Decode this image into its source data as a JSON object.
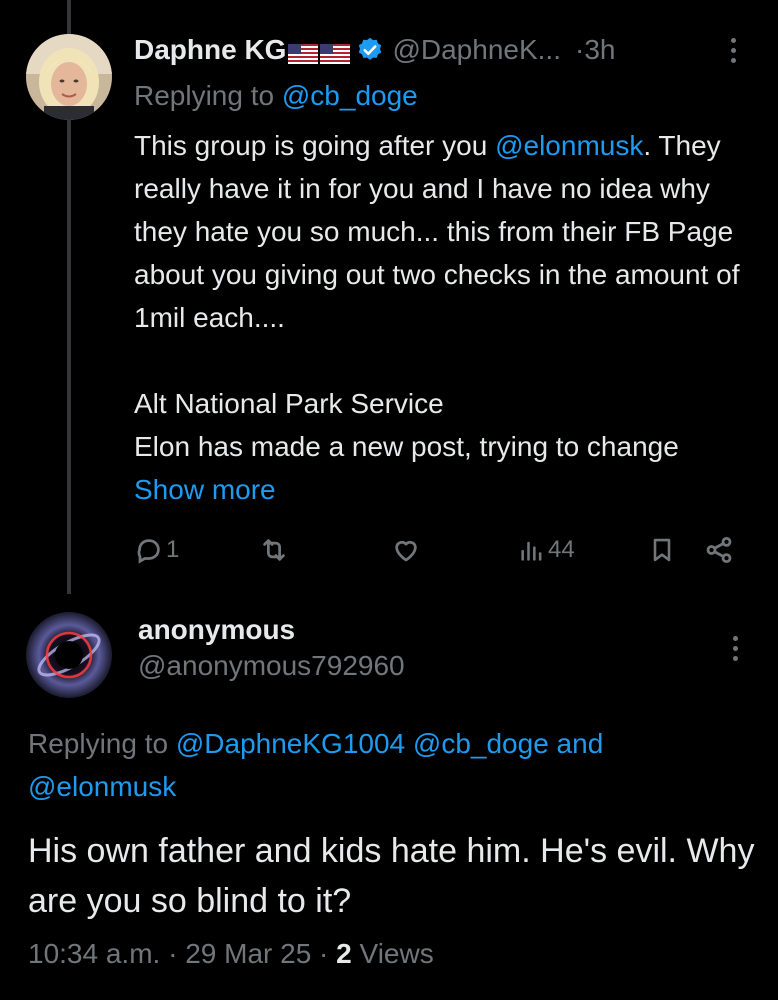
{
  "thread_tweet": {
    "author_name": "Daphne KG",
    "flags_icon": "us-flag-icon",
    "handle": "@DaphneK...",
    "separator": "·",
    "time": "3h",
    "replying_prefix": "Replying to ",
    "replying_to": "@cb_doge",
    "body_lines": {
      "p1_start": "This group is going after you ",
      "p1_mention": "@elonmusk",
      "p1_end": ". They really have it in for you and I have no idea why they hate you so much... this from their FB Page about you giving out two checks in the amount of 1mil each....",
      "p2_line1": "Alt National Park Service",
      "p2_text": "Elon has made a new post, trying to change ",
      "show_more": "Show more"
    },
    "stats": {
      "replies": "1",
      "reposts": "",
      "likes": "",
      "views": "44"
    }
  },
  "reply_tweet": {
    "author_name": "anonymous",
    "handle": "@anonymous792960",
    "replying_prefix": "Replying to ",
    "replying_user1": "@DaphneKG1004",
    "replying_user2": "@cb_doge",
    "replying_and": " and ",
    "replying_user3": "@elonmusk",
    "body": "His own father and kids hate him. He's evil. Why are you so blind to it?",
    "meta_time": "10:34 a.m.",
    "meta_sep1": " · ",
    "meta_date": "29 Mar 25",
    "meta_sep2": " · ",
    "meta_views_count": "2",
    "meta_views_label": " Views"
  },
  "colors": {
    "background": "#000000",
    "text": "#e7e9ea",
    "muted": "#71767b",
    "link": "#1d9bf0",
    "thread_line": "#333639"
  }
}
